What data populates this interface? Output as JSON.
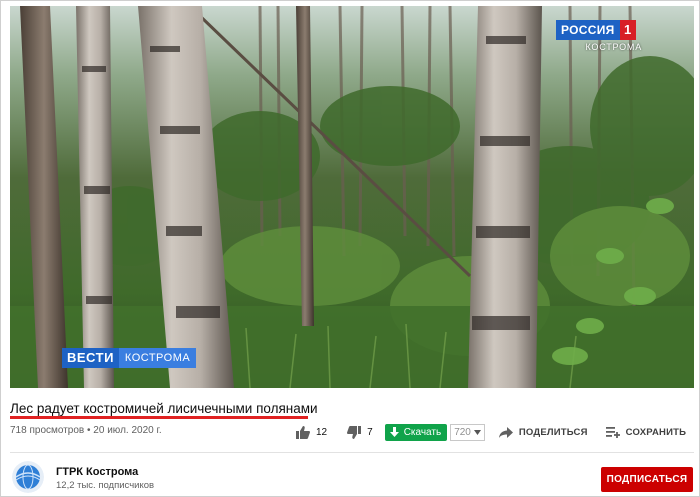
{
  "video": {
    "channel_logo": {
      "name": "РОССИЯ",
      "number": "1",
      "region": "КОСТРОМА"
    },
    "news_logo": {
      "brand": "ВЕСТИ",
      "region": "КОСТРОМА"
    }
  },
  "title": "Лес радует костромичей лисичечными полянами",
  "meta": {
    "views": "718 просмотров",
    "date": "20 июл. 2020 г."
  },
  "actions": {
    "likes": "12",
    "dislikes": "7",
    "download_label": "Скачать",
    "quality": "720",
    "share_label": "ПОДЕЛИТЬСЯ",
    "save_label": "СОХРАНИТЬ",
    "more_label": "..."
  },
  "channel": {
    "name": "ГТРК Кострома",
    "subscribers": "12,2 тыс. подписчиков",
    "subscribe_label": "ПОДПИСАТЬСЯ"
  },
  "colors": {
    "accent_red": "#cc0000",
    "title_underline": "#e02222",
    "download_green": "#10a34a",
    "rossiya_blue": "#1e62c4",
    "rossiya_red": "#d81f26"
  },
  "icons": {
    "like": "thumbs-up-icon",
    "dislike": "thumbs-down-icon",
    "download": "download-arrow-icon",
    "share": "share-arrow-icon",
    "save": "playlist-add-icon",
    "more": "more-dots-icon"
  }
}
